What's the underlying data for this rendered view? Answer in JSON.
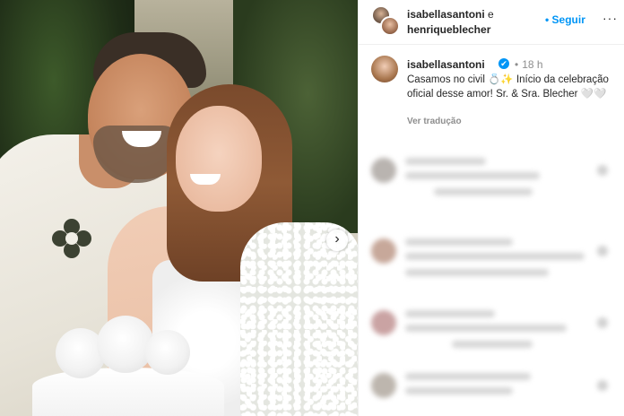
{
  "post": {
    "header": {
      "user1": "isabellasantoni",
      "conjunction": "e",
      "user2": "henriqueblecher",
      "follow_label": "Seguir",
      "more_label": "···"
    },
    "caption": {
      "username": "isabellasantoni",
      "verified_glyph": "✔",
      "time_dot": "•",
      "time": "18 h",
      "text": "Casamos no civil 💍✨ Início da celebração oficial desse amor! Sr. & Sra. Blecher 🤍🤍",
      "translate_label": "Ver tradução"
    },
    "carousel": {
      "next_glyph": "›"
    }
  },
  "colors": {
    "accent": "#0095f6",
    "text": "#262626",
    "muted": "#8e8e8e"
  },
  "icons": [
    "verified-badge-icon",
    "more-options-icon",
    "carousel-next-icon"
  ]
}
